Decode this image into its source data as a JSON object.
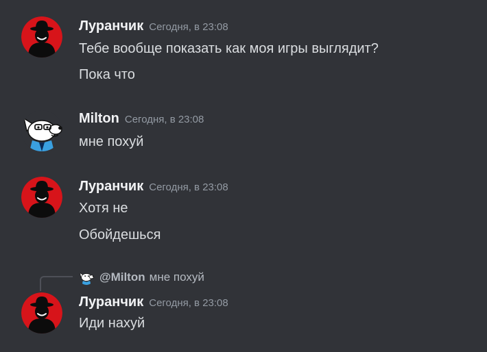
{
  "messages": [
    {
      "author": "Луранчик",
      "avatar_icon": "red-hat-figure-avatar",
      "timestamp": "Сегодня, в 23:08",
      "lines": [
        "Тебе вообще показать как моя игры выглядит?",
        "Пока что"
      ]
    },
    {
      "author": "Milton",
      "avatar_icon": "cartoon-dog-avatar",
      "timestamp": "Сегодня, в 23:08",
      "lines": [
        "мне похуй"
      ]
    },
    {
      "author": "Луранчик",
      "avatar_icon": "red-hat-figure-avatar",
      "timestamp": "Сегодня, в 23:08",
      "lines": [
        "Хотя не",
        "Обойдешься"
      ]
    },
    {
      "reply": {
        "author": "@Milton",
        "text": "мне похуй",
        "avatar_icon": "cartoon-dog-avatar"
      },
      "author": "Луранчик",
      "avatar_icon": "red-hat-figure-avatar",
      "timestamp": "Сегодня, в 23:08",
      "lines": [
        "Иди нахуй"
      ]
    }
  ],
  "colors": {
    "background": "#313338",
    "username": "#f2f3f5",
    "text": "#dbdee1",
    "timestamp": "#949ba4",
    "reply_line": "#4e5058",
    "avatar_red": "#d7141a"
  }
}
